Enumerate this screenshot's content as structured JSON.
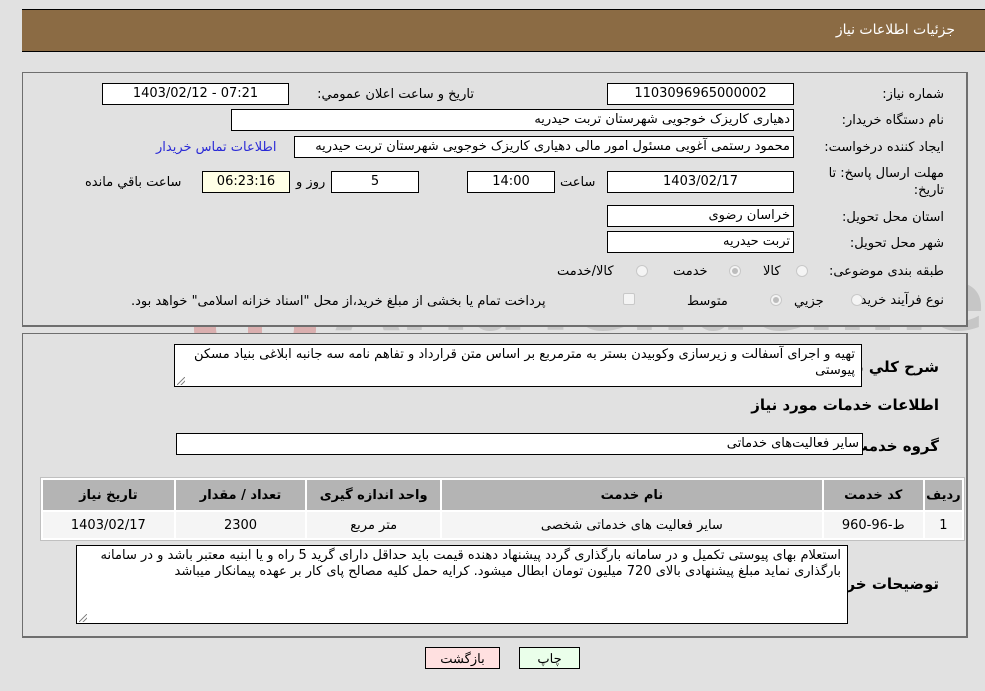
{
  "header": {
    "title": "جزئیات اطلاعات نیاز"
  },
  "details": {
    "need_number_label": "شماره نیاز:",
    "need_number": "1103096965000002",
    "announce_label": "تاریخ و ساعت اعلان عمومي:",
    "announce_value": "1403/02/12 - 07:21",
    "buyer_org_label": "نام دستگاه خریدار:",
    "buyer_org": "دهیاری کاریزک خوجویی  شهرستان تربت حیدریه",
    "creator_label": "ایجاد کننده درخواست:",
    "creator": "محمود رستمی آغویی مسئول امور مالی  دهیاری کاریزک خوجویی  شهرستان تربت حیدریه",
    "contact_link": "اطلاعات تماس خریدار",
    "deadline_label": "مهلت ارسال پاسخ: تا تاریخ:",
    "deadline_date": "1403/02/17",
    "time_label": "ساعت",
    "deadline_time": "14:00",
    "days_value": "5",
    "days_label": "روز و",
    "remaining_time": "06:23:16",
    "remaining_label": "ساعت باقي مانده",
    "province_label": "استان محل تحویل:",
    "province": "خراسان رضوی",
    "city_label": "شهر محل تحویل:",
    "city": "تربت حیدریه",
    "category_label": "طبقه بندی موضوعی:",
    "category_options": [
      {
        "label": "کالا",
        "checked": false
      },
      {
        "label": "خدمت",
        "checked": true
      },
      {
        "label": "کالا/خدمت",
        "checked": false
      }
    ],
    "process_label": "نوع فرآیند خرید :",
    "process_options": [
      {
        "label": "جزيي",
        "checked": false
      },
      {
        "label": "متوسط",
        "checked": true
      }
    ],
    "treasury_checkbox_label": "پرداخت تمام یا بخشی از مبلغ خرید،از محل \"اسناد خزانه اسلامی\" خواهد بود."
  },
  "needs": {
    "summary_label": "شرح کلي نياز:",
    "summary": "تهیه و اجرای آسفالت و زیرسازی وکوبیدن بستر به مترمربع بر اساس متن قرارداد و تفاهم نامه سه جانبه ابلاغی بنیاد مسکن پیوستی",
    "services_heading": "اطلاعات خدمات مورد نياز",
    "service_group_label": "گروه خدمت:",
    "service_group": "سایر فعالیت‌های خدماتی",
    "table": {
      "headers": [
        "ردیف",
        "کد خدمت",
        "نام خدمت",
        "واحد اندازه گیری",
        "تعداد / مقدار",
        "تاریخ نیاز"
      ],
      "rows": [
        [
          "1",
          "ط-96-960",
          "سایر فعالیت های خدماتی شخصی",
          "متر مربع",
          "2300",
          "1403/02/17"
        ]
      ]
    },
    "buyer_notes_label": "توضیحات خریدار:",
    "buyer_notes": "استعلام بهای پیوستی تکمیل و در سامانه بارگذاری گردد پیشنهاد دهنده قیمت باید حداقل دارای گرید 5 راه و یا ابنیه معتبر باشد و در سامانه بارگذاری نماید مبلغ پیشنهادی بالای 720 میلیون تومان ابطال میشود. کرایه حمل کلیه مصالح پای کار بر عهده پیمانکار میباشد"
  },
  "buttons": {
    "print": "چاپ",
    "back": "بازگشت"
  },
  "colors": {
    "header_bg": "#8b6b44",
    "print_bg": "#eaffea",
    "back_bg": "#ffe0e0",
    "link": "#2a2ad6"
  },
  "watermark": {
    "text": "AriaTender.neT"
  }
}
